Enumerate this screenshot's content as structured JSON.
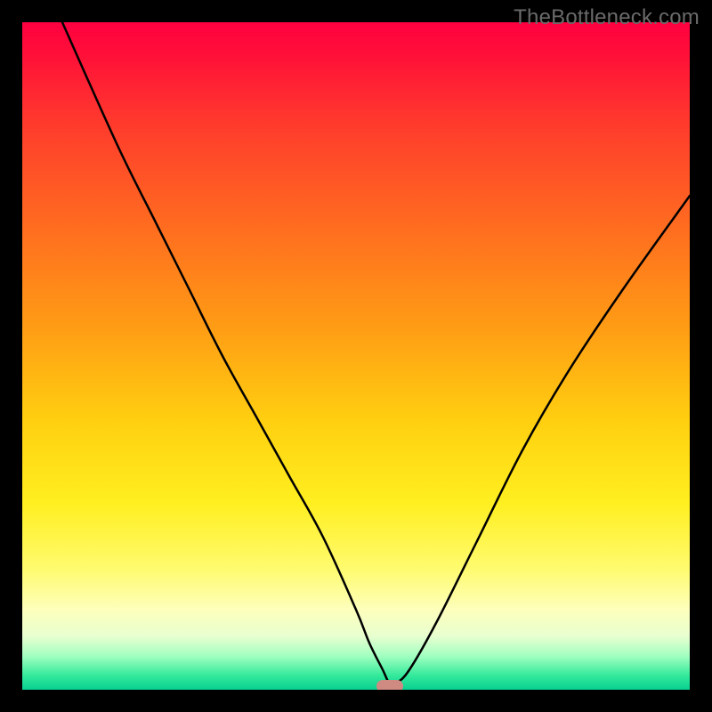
{
  "watermark": "TheBottleneck.com",
  "chart_data": {
    "type": "line",
    "title": "",
    "xlabel": "",
    "ylabel": "",
    "xlim": [
      0,
      100
    ],
    "ylim": [
      0,
      100
    ],
    "grid": false,
    "legend": false,
    "series": [
      {
        "name": "bottleneck-curve",
        "x": [
          6,
          10,
          15,
          20,
          25,
          30,
          35,
          40,
          45,
          50,
          52,
          54,
          55,
          56,
          58,
          62,
          68,
          75,
          82,
          90,
          100
        ],
        "y": [
          100,
          91,
          80,
          70,
          60,
          50,
          41,
          32,
          23,
          12,
          7,
          3,
          1,
          1,
          3,
          10,
          22,
          36,
          48,
          60,
          74
        ]
      }
    ],
    "marker": {
      "name": "optimal-point",
      "x": 55,
      "y": 0,
      "color": "#cf8a82"
    },
    "background_gradient": {
      "top": "#ff0040",
      "middle": "#ffef20",
      "bottom": "#08d090"
    }
  }
}
